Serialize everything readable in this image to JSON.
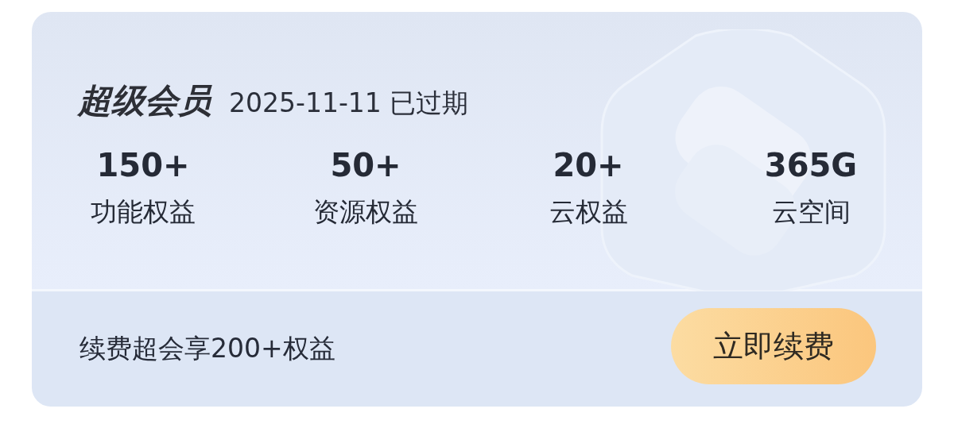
{
  "membership": {
    "title": "超级会员",
    "expiry": "2025-11-11 已过期"
  },
  "stats": [
    {
      "value": "150+",
      "label": "功能权益"
    },
    {
      "value": "50+",
      "label": "资源权益"
    },
    {
      "value": "20+",
      "label": "云权益"
    },
    {
      "value": "365G",
      "label": "云空间"
    }
  ],
  "footer": {
    "promo": "续费超会享200+权益",
    "button": "立即续费"
  }
}
